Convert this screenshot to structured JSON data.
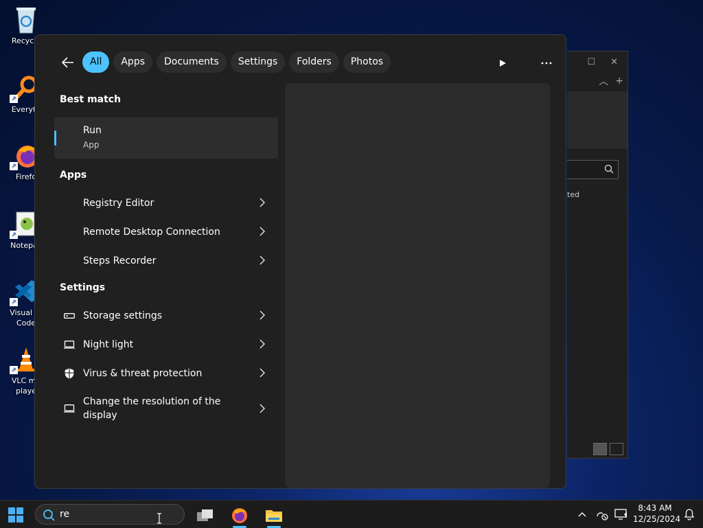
{
  "desktop": {
    "icons": [
      {
        "label": "Recycle"
      },
      {
        "label": "Everyth"
      },
      {
        "label": "Firefo"
      },
      {
        "label": "Notepac"
      },
      {
        "label": "Visual St\nCode"
      },
      {
        "label": "VLC me\nplaye"
      }
    ]
  },
  "bg_window": {
    "partial_text": "ted"
  },
  "search_panel": {
    "filters": [
      "All",
      "Apps",
      "Documents",
      "Settings",
      "Folders",
      "Photos"
    ],
    "best_match": {
      "heading": "Best match",
      "title": "Run",
      "subtitle": "App"
    },
    "apps": {
      "heading": "Apps",
      "items": [
        "Registry Editor",
        "Remote Desktop Connection",
        "Steps Recorder"
      ]
    },
    "settings": {
      "heading": "Settings",
      "items": [
        {
          "label": "Storage settings",
          "icon": "storage-icon"
        },
        {
          "label": "Night light",
          "icon": "display-icon"
        },
        {
          "label": "Virus & threat protection",
          "icon": "shield-icon"
        },
        {
          "label": "Change the resolution of the display",
          "icon": "display-icon"
        }
      ]
    }
  },
  "taskbar": {
    "search_value": "re",
    "time": "8:43 AM",
    "date": "12/25/2024"
  },
  "colors": {
    "accent": "#4cc2ff",
    "panel": "#202020",
    "taskbar": "#1c1c1c"
  }
}
